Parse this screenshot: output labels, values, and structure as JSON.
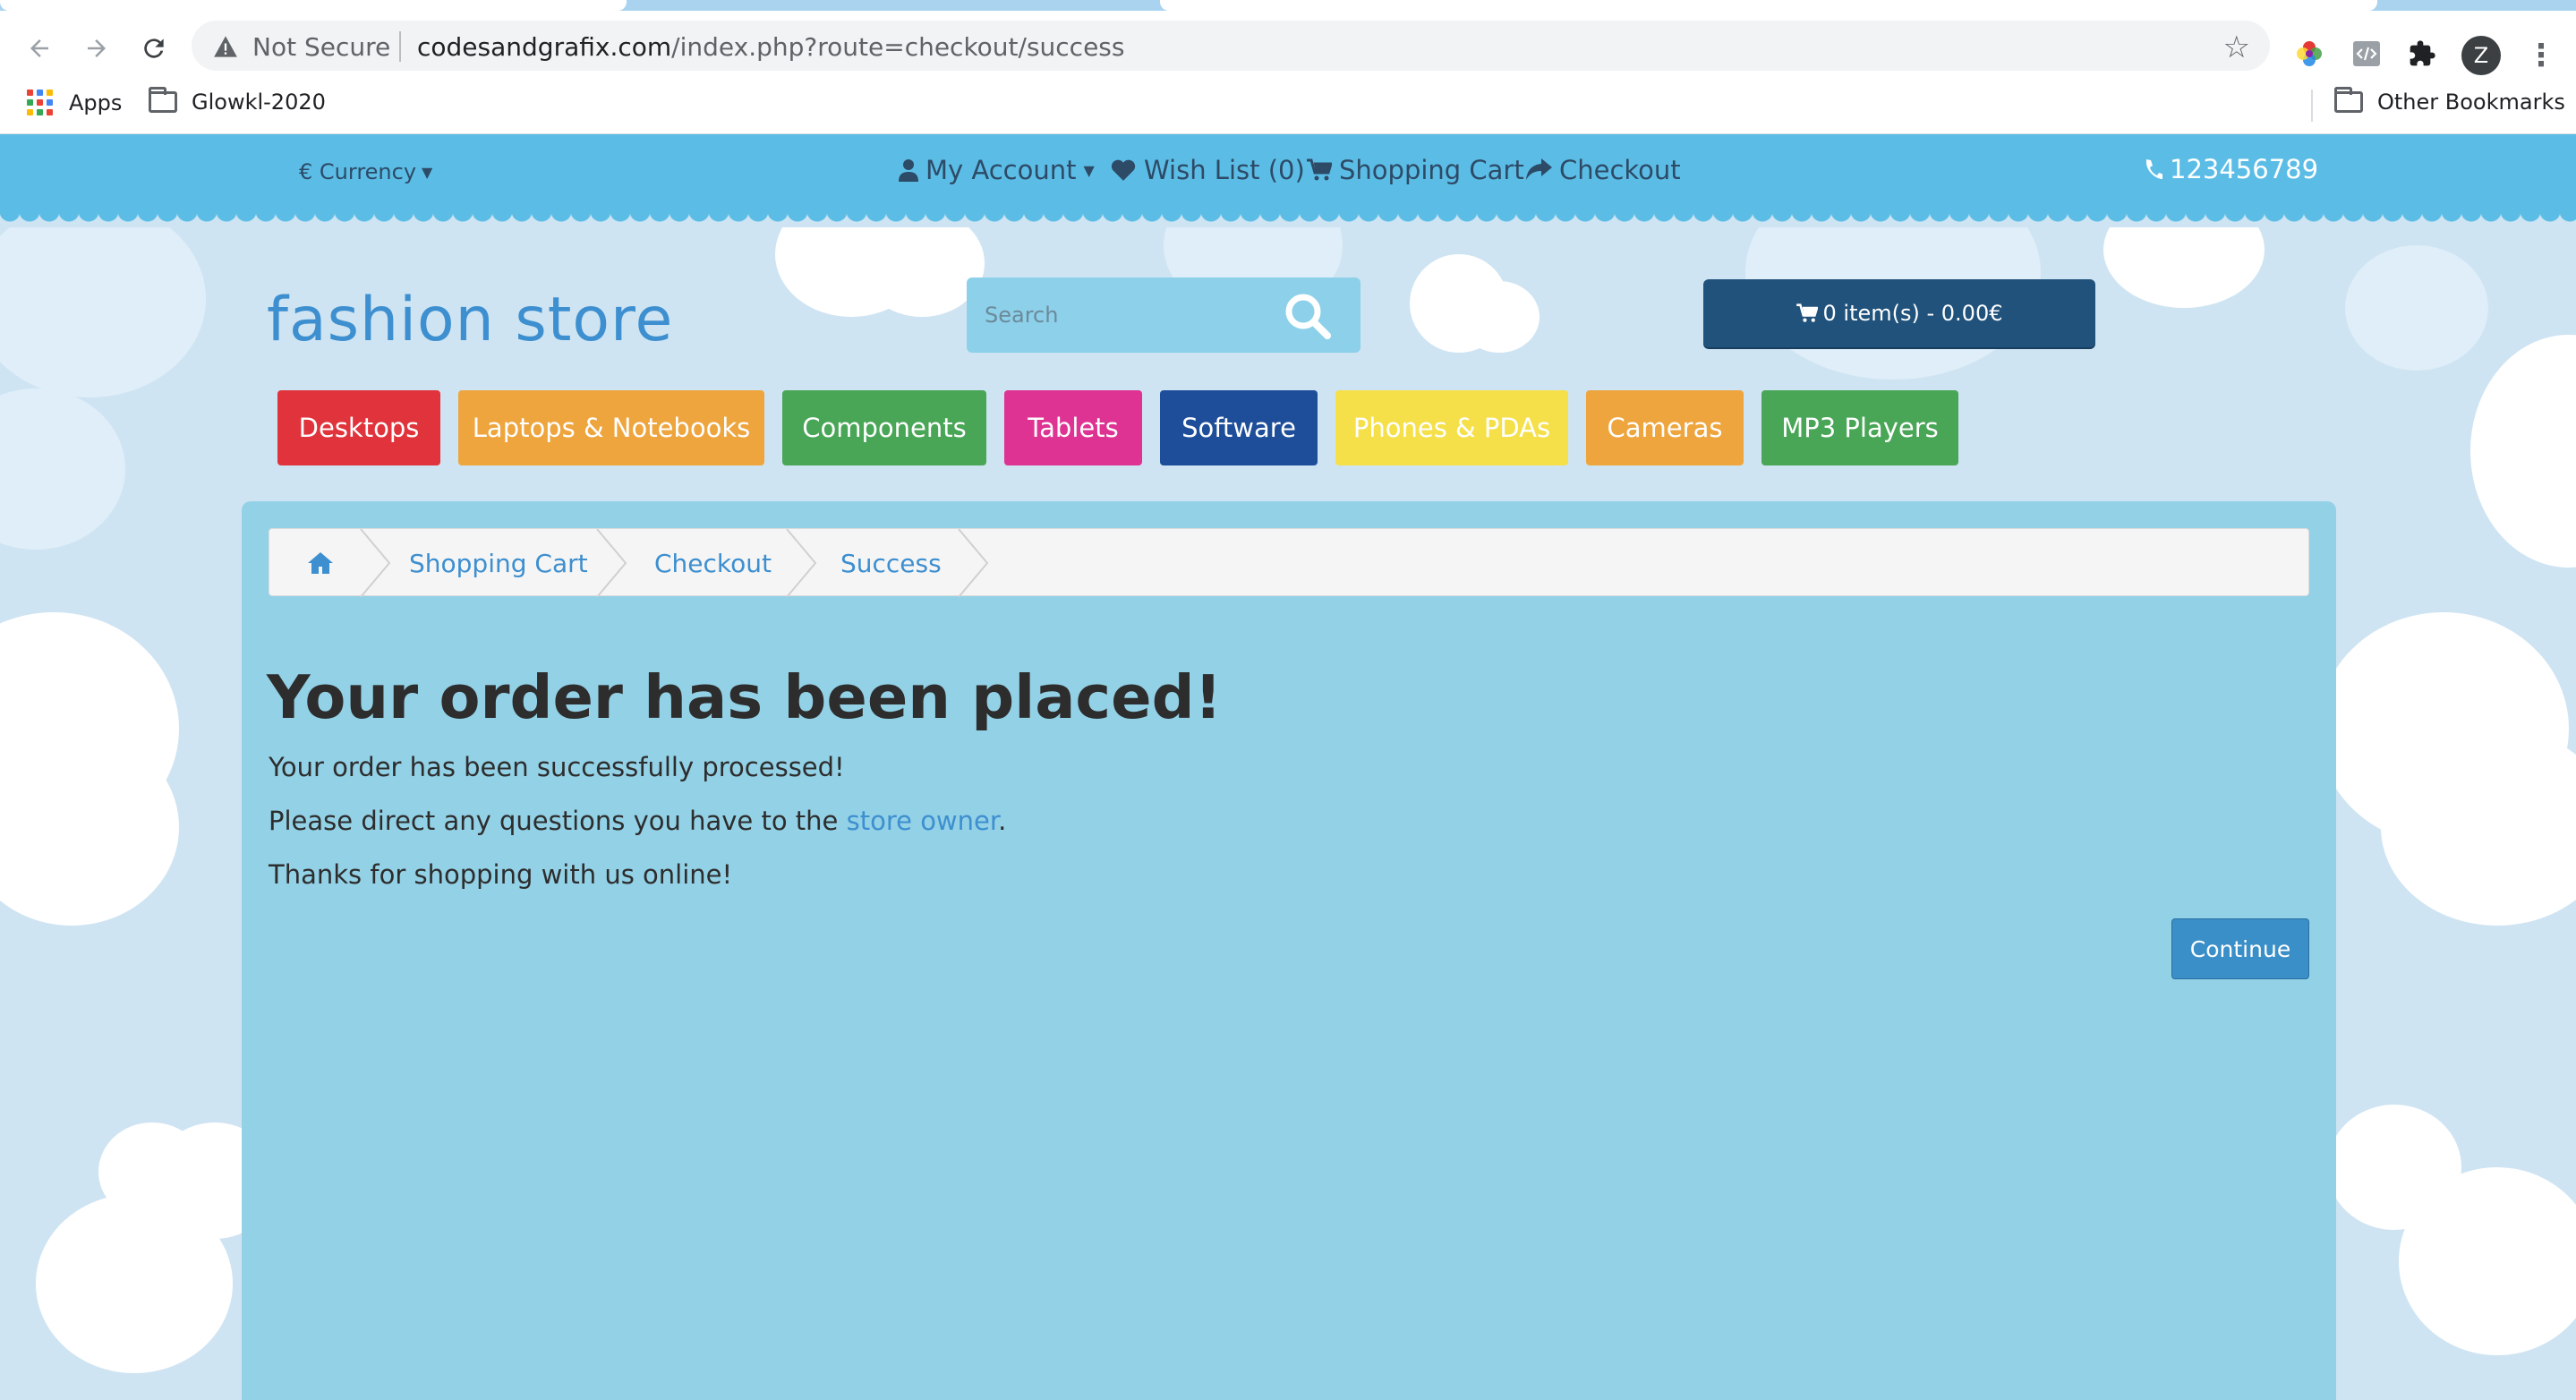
{
  "browser": {
    "security_label": "Not Secure",
    "url_host": "codesandgrafix.com",
    "url_path": "/index.php?route=checkout/success",
    "icons": [
      "back-icon",
      "forward-icon",
      "reload-icon",
      "warning-icon",
      "bookmark-star-icon",
      "color-picker-extension-icon",
      "code-extension-icon",
      "puzzle-extensions-icon",
      "profile-avatar",
      "more-vert-icon"
    ],
    "profile_initial": "Z",
    "bookmarks": {
      "apps_label": "Apps",
      "folder_label": "Glowkl-2020",
      "other_label": "Other Bookmarks"
    }
  },
  "topbar": {
    "currency_label": "€ Currency",
    "my_account_label": "My Account",
    "wishlist_label": "Wish List (0)",
    "cart_label": "Shopping Cart",
    "checkout_label": "Checkout",
    "phone_label": "123456789"
  },
  "header": {
    "logo_text": "fashion store",
    "search_placeholder": "Search",
    "cart_summary": "0 item(s) - 0.00€"
  },
  "menu": {
    "items": [
      {
        "label": "Desktops",
        "color": "#e0333b"
      },
      {
        "label": "Laptops & Notebooks",
        "color": "#eea53d"
      },
      {
        "label": "Components",
        "color": "#48a656"
      },
      {
        "label": "Tablets",
        "color": "#de3393"
      },
      {
        "label": "Software",
        "color": "#1e4e9a"
      },
      {
        "label": "Phones & PDAs",
        "color": "#f5e04a"
      },
      {
        "label": "Cameras",
        "color": "#eea53d"
      },
      {
        "label": "MP3 Players",
        "color": "#48a656"
      }
    ]
  },
  "breadcrumb": {
    "home_icon": "home-icon",
    "items": [
      "Shopping Cart",
      "Checkout",
      "Success"
    ]
  },
  "content": {
    "title": "Your order has been placed!",
    "line1": "Your order has been successfully processed!",
    "line2_prefix": "Please direct any questions you have to the ",
    "line2_link": "store owner",
    "line2_suffix": ".",
    "line3": "Thanks for shopping with us online!",
    "continue_label": "Continue"
  },
  "colors": {
    "topbar": "#5bbde6",
    "panel": "#93d1e6",
    "link": "#3d8fd0",
    "cart_button": "#20527c"
  }
}
